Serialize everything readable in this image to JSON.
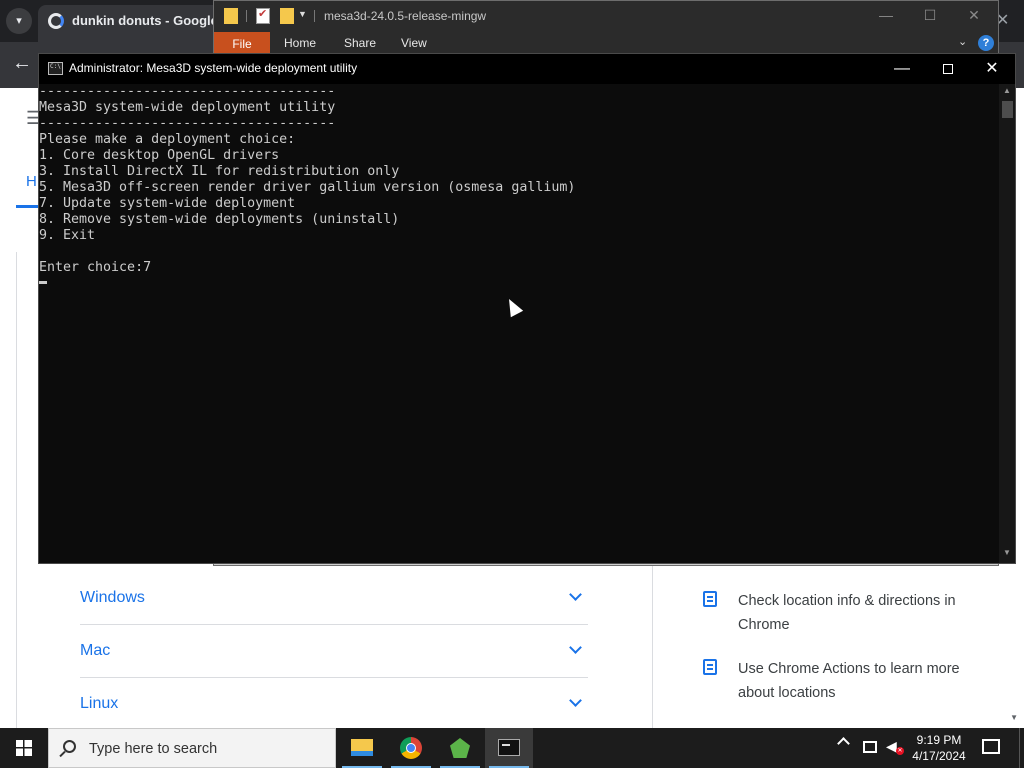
{
  "chrome": {
    "tab_title": "dunkin donuts - Google Se",
    "close_peek": "✕",
    "back_glyph": "←",
    "menu_glyph": "☰",
    "h_link": "H",
    "accordion": [
      {
        "label": "Windows"
      },
      {
        "label": "Mac"
      },
      {
        "label": "Linux"
      }
    ],
    "side_links": [
      {
        "text": "Check location info & directions in Chrome"
      },
      {
        "text": "Use Chrome Actions to learn more about locations"
      }
    ]
  },
  "explorer": {
    "title": "mesa3d-24.0.5-release-mingw",
    "ribbon_tabs": {
      "file": "File",
      "home": "Home",
      "share": "Share",
      "view": "View"
    },
    "help": "?",
    "controls": {
      "minimize": "—",
      "maximize": "☐",
      "close": "✕"
    }
  },
  "console": {
    "title": "Administrator:  Mesa3D system-wide deployment utility",
    "controls": {
      "minimize": "—",
      "close": "✕"
    },
    "lines": [
      "-------------------------------------",
      "Mesa3D system-wide deployment utility",
      "-------------------------------------",
      "Please make a deployment choice:",
      "1. Core desktop OpenGL drivers",
      "3. Install DirectX IL for redistribution only",
      "5. Mesa3D off-screen render driver gallium version (osmesa gallium)",
      "7. Update system-wide deployment",
      "8. Remove system-wide deployments (uninstall)",
      "9. Exit",
      "",
      "Enter choice:7"
    ]
  },
  "taskbar": {
    "search_placeholder": "Type here to search",
    "time": "9:19 PM",
    "date": "4/17/2024",
    "apps": [
      "file-explorer",
      "google-chrome",
      "mesa3d",
      "command-prompt"
    ],
    "active_app": "command-prompt"
  },
  "colors": {
    "console_bg": "#0c0c0c",
    "console_text": "#cccccc",
    "link_blue": "#1a73e8",
    "file_tab": "#c8501e",
    "taskbar": "#1c1c1c"
  }
}
